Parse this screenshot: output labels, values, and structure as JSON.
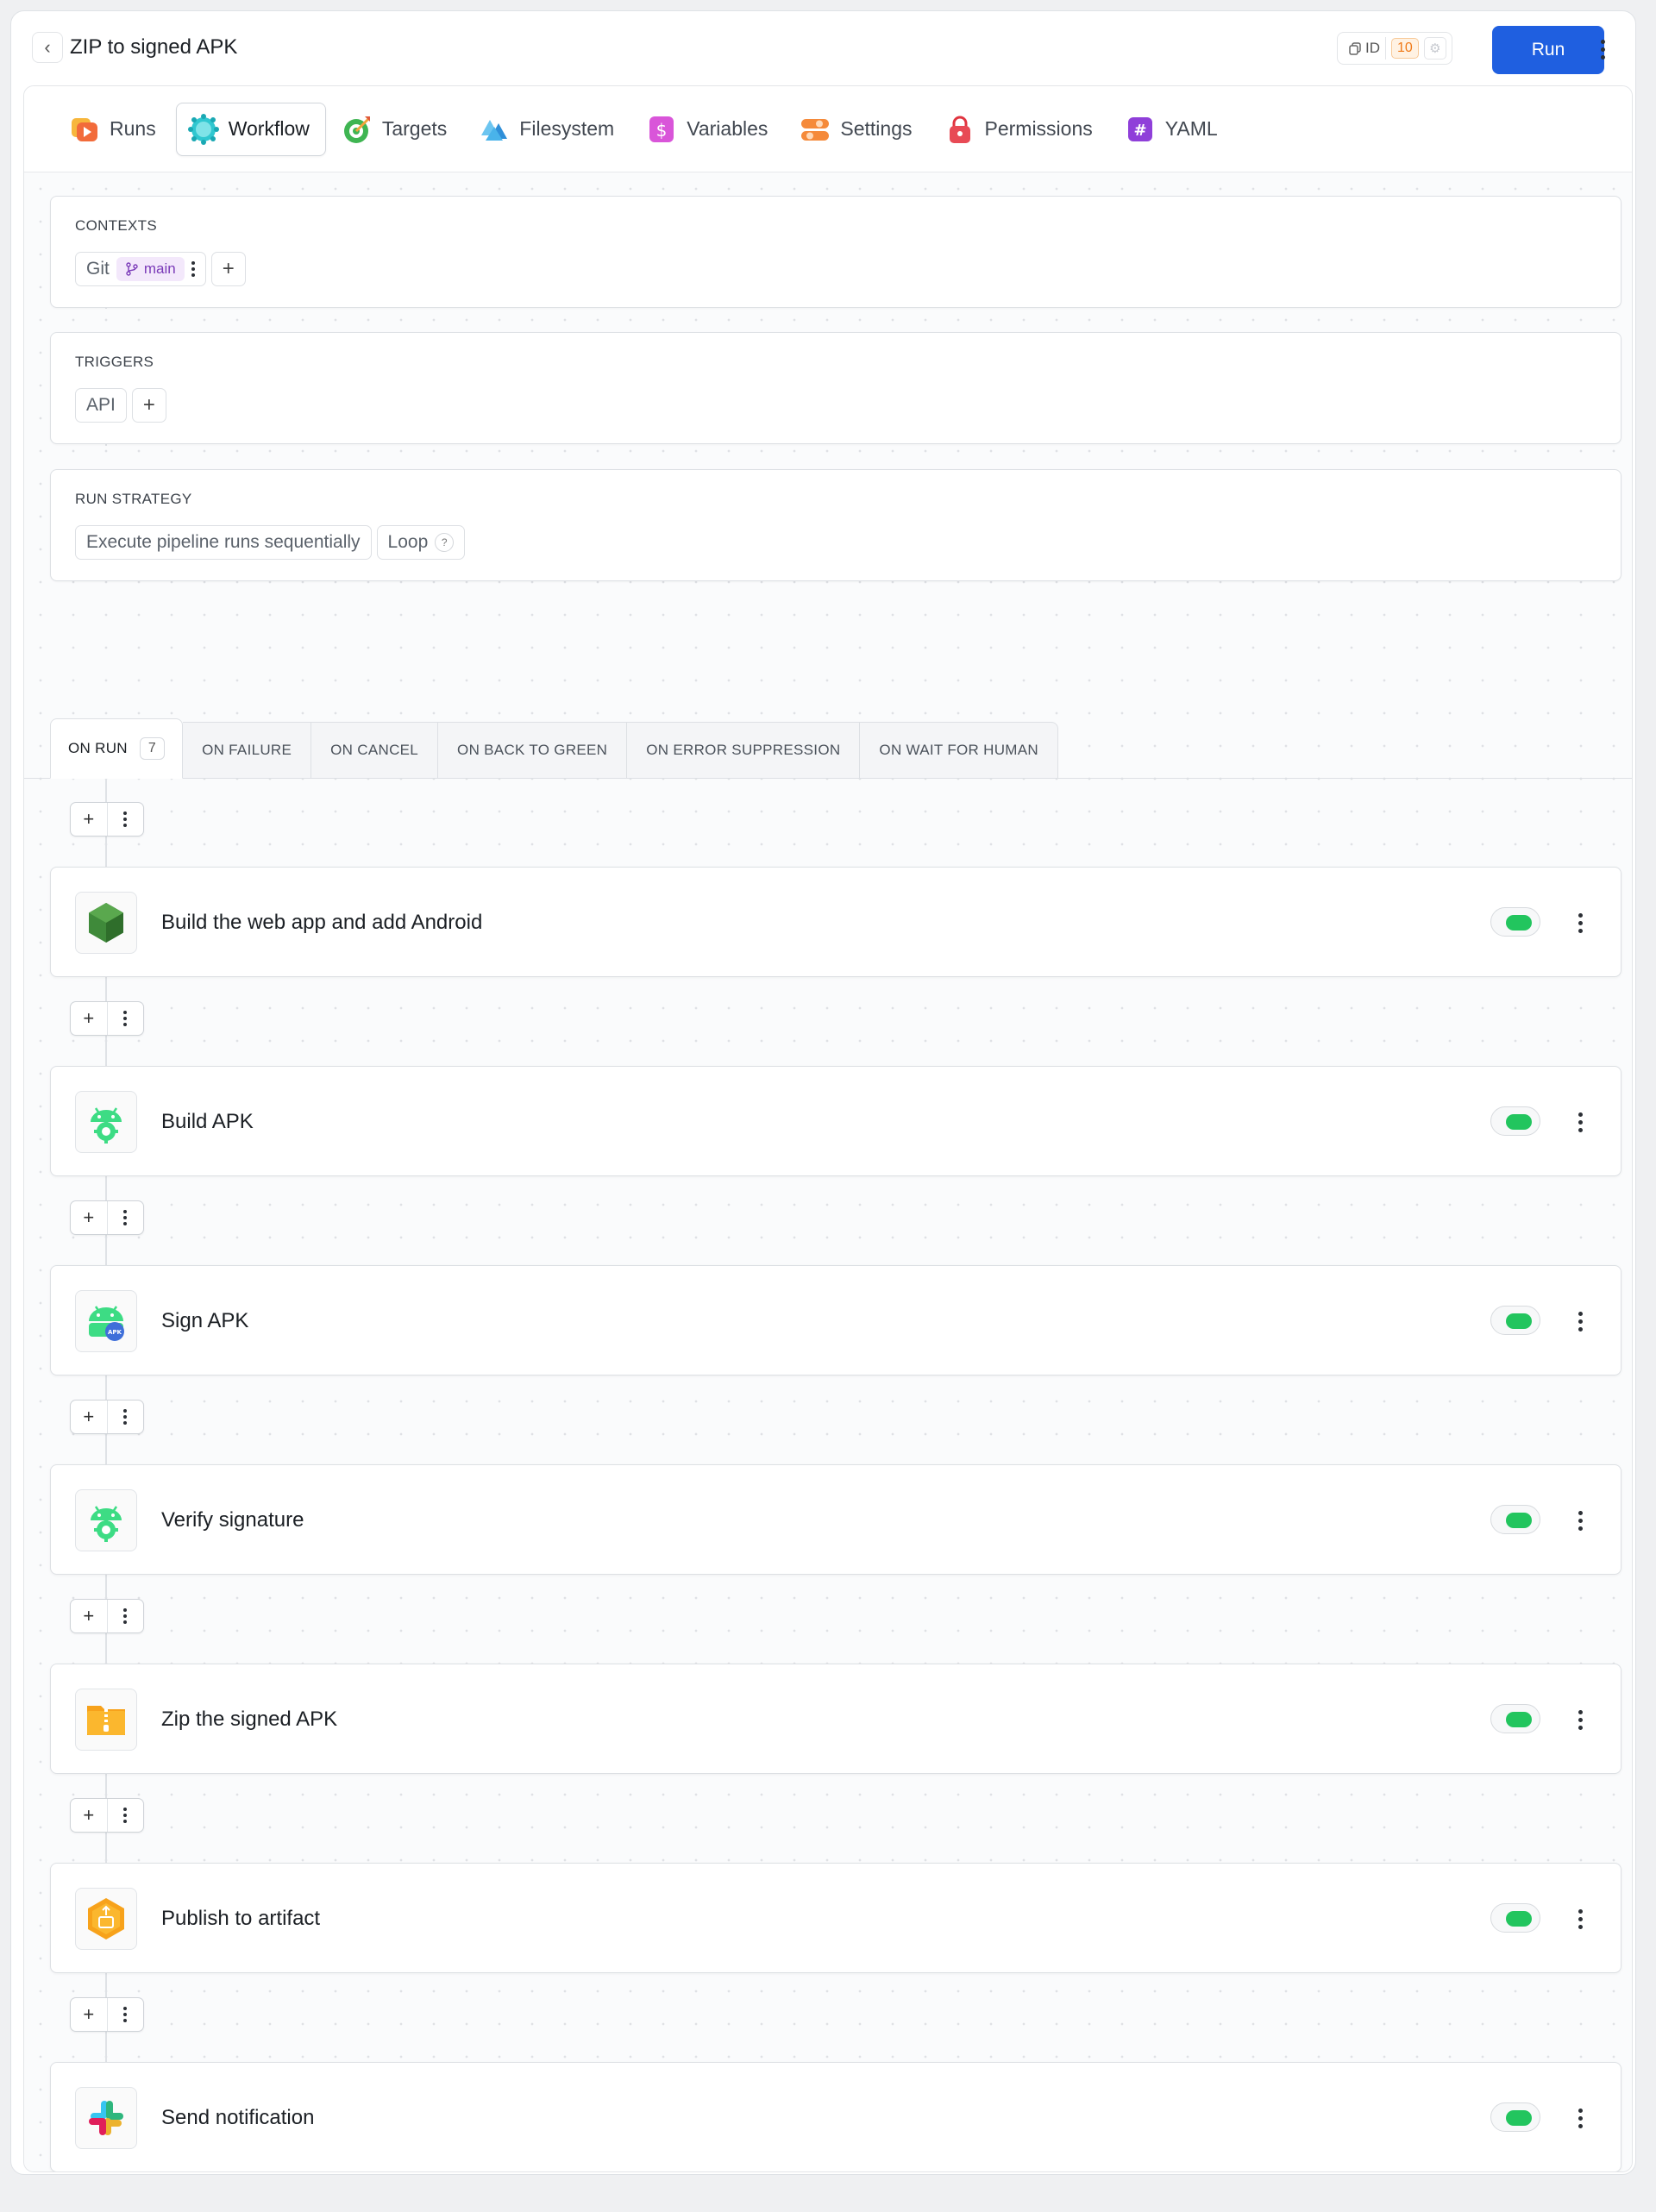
{
  "header": {
    "title": "ZIP to signed APK",
    "id_label": "ID",
    "id_count": "10",
    "run_label": "Run"
  },
  "tabs": [
    {
      "label": "Runs",
      "icon": "runs-icon"
    },
    {
      "label": "Workflow",
      "icon": "workflow-icon",
      "active": true
    },
    {
      "label": "Targets",
      "icon": "targets-icon"
    },
    {
      "label": "Filesystem",
      "icon": "filesystem-icon"
    },
    {
      "label": "Variables",
      "icon": "variables-icon"
    },
    {
      "label": "Settings",
      "icon": "settings-icon"
    },
    {
      "label": "Permissions",
      "icon": "permissions-icon"
    },
    {
      "label": "YAML",
      "icon": "yaml-icon"
    }
  ],
  "contexts": {
    "label": "CONTEXTS",
    "git_label": "Git",
    "branch": "main"
  },
  "triggers": {
    "label": "TRIGGERS",
    "items": [
      "API"
    ]
  },
  "run_strategy": {
    "label": "RUN STRATEGY",
    "mode": "Execute pipeline runs sequentially",
    "loop_label": "Loop",
    "help": "?"
  },
  "action_tabs": [
    {
      "label": "ON RUN",
      "count": "7",
      "active": true
    },
    {
      "label": "ON FAILURE"
    },
    {
      "label": "ON CANCEL"
    },
    {
      "label": "ON BACK TO GREEN"
    },
    {
      "label": "ON ERROR SUPPRESSION"
    },
    {
      "label": "ON WAIT FOR HUMAN"
    }
  ],
  "actions": [
    {
      "name": "Build the web app and add Android",
      "icon": "nodejs-icon",
      "enabled": true
    },
    {
      "name": "Build APK",
      "icon": "android-gear-icon",
      "enabled": true
    },
    {
      "name": "Sign APK",
      "icon": "android-apk-icon",
      "enabled": true
    },
    {
      "name": "Verify signature",
      "icon": "android-gear-icon",
      "enabled": true
    },
    {
      "name": "Zip the signed APK",
      "icon": "zip-folder-icon",
      "enabled": true
    },
    {
      "name": "Publish to artifact",
      "icon": "artifact-icon",
      "enabled": true
    },
    {
      "name": "Send notification",
      "icon": "slack-icon",
      "enabled": true
    }
  ],
  "colors": {
    "accent": "#1f5fe0",
    "toggle_on": "#22c55e",
    "branch_bg": "#f3e8fb",
    "branch_fg": "#7a3ab8"
  }
}
